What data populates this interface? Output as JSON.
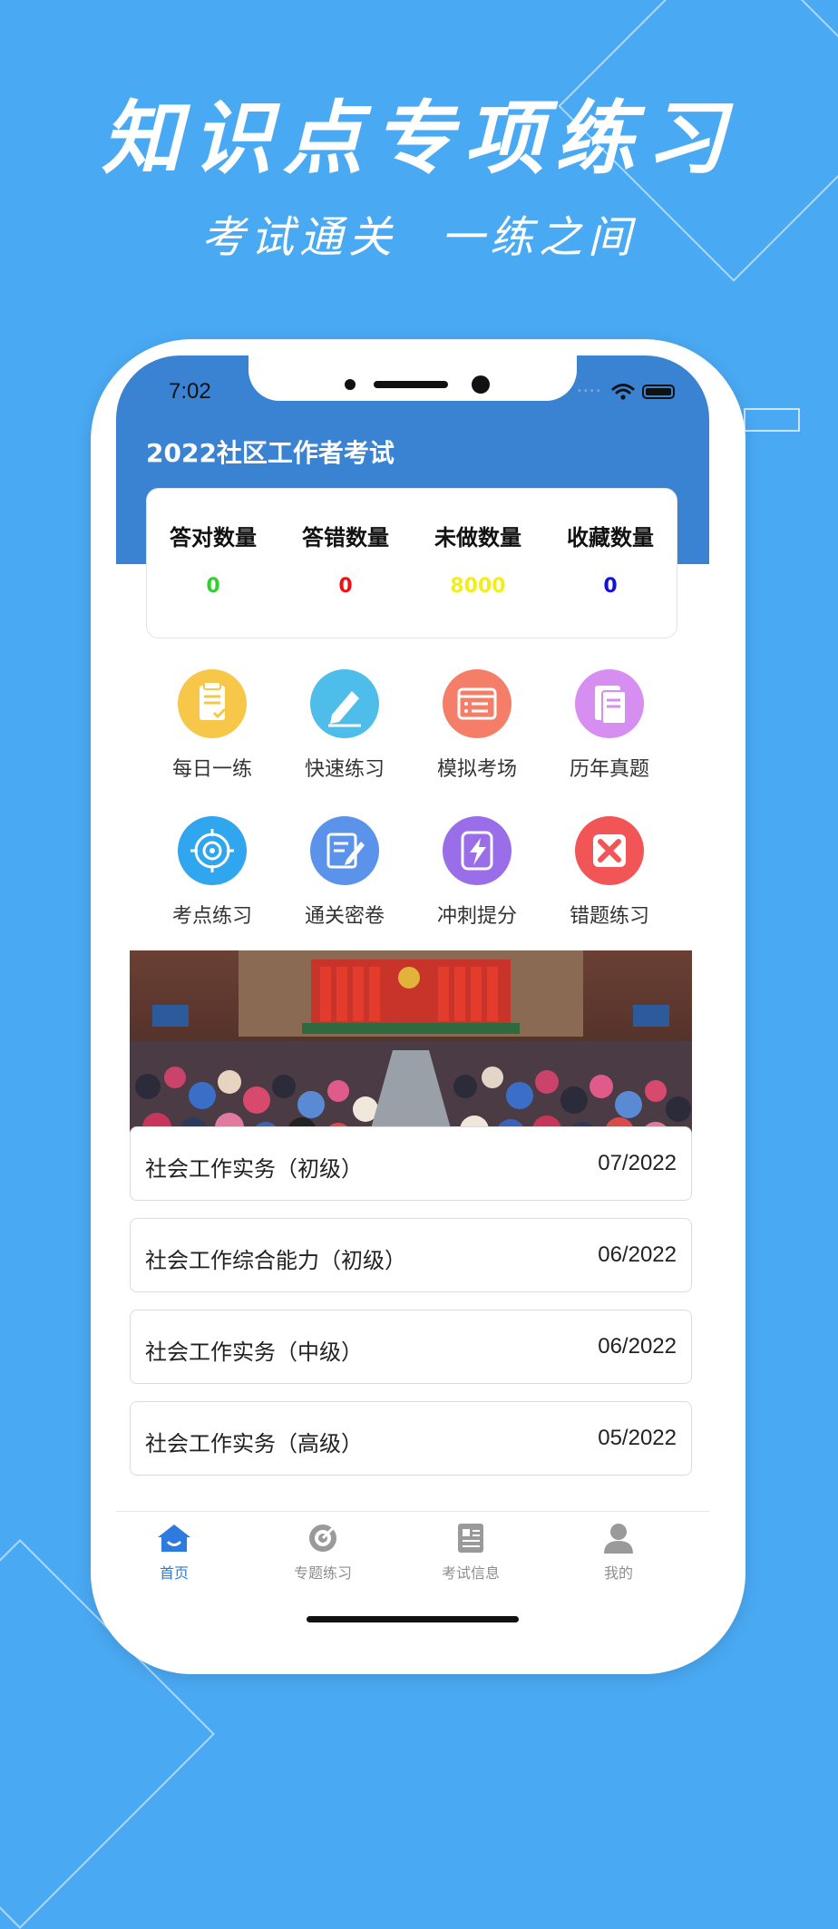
{
  "promo": {
    "headline": "知识点专项练习",
    "subline_left": "考试通关",
    "subline_right": "一练之间"
  },
  "status_bar": {
    "time": "7:02"
  },
  "app": {
    "title": "2022社区工作者考试"
  },
  "stats": [
    {
      "label": "答对数量",
      "value": "0",
      "color": "#2fd12f"
    },
    {
      "label": "答错数量",
      "value": "0",
      "color": "#ee1111"
    },
    {
      "label": "未做数量",
      "value": "8000",
      "color": "#f3ee1a"
    },
    {
      "label": "收藏数量",
      "value": "0",
      "color": "#1111dd"
    }
  ],
  "features": [
    {
      "label": "每日一练",
      "icon": "daily-clipboard-icon",
      "color": "#f7c74a"
    },
    {
      "label": "快速练习",
      "icon": "pencil-icon",
      "color": "#4fbde9"
    },
    {
      "label": "模拟考场",
      "icon": "checklist-icon",
      "color": "#f47e68"
    },
    {
      "label": "历年真题",
      "icon": "documents-icon",
      "color": "#d68ef0"
    },
    {
      "label": "考点练习",
      "icon": "target-icon",
      "color": "#2fa6ee"
    },
    {
      "label": "通关密卷",
      "icon": "edit-paper-icon",
      "color": "#5b93ea"
    },
    {
      "label": "冲刺提分",
      "icon": "lightning-icon",
      "color": "#9a6ee8"
    },
    {
      "label": "错题练习",
      "icon": "wrong-x-icon",
      "color": "#f25555"
    }
  ],
  "exams": [
    {
      "title": "社会工作实务（初级）",
      "date": "07/2022"
    },
    {
      "title": "社会工作综合能力（初级）",
      "date": "06/2022"
    },
    {
      "title": "社会工作实务（中级）",
      "date": "06/2022"
    },
    {
      "title": "社会工作实务（高级）",
      "date": "05/2022"
    }
  ],
  "tabs": [
    {
      "label": "首页",
      "icon": "home-icon",
      "active": true
    },
    {
      "label": "专题练习",
      "icon": "target-tab-icon",
      "active": false
    },
    {
      "label": "考试信息",
      "icon": "news-icon",
      "active": false
    },
    {
      "label": "我的",
      "icon": "user-icon",
      "active": false
    }
  ]
}
